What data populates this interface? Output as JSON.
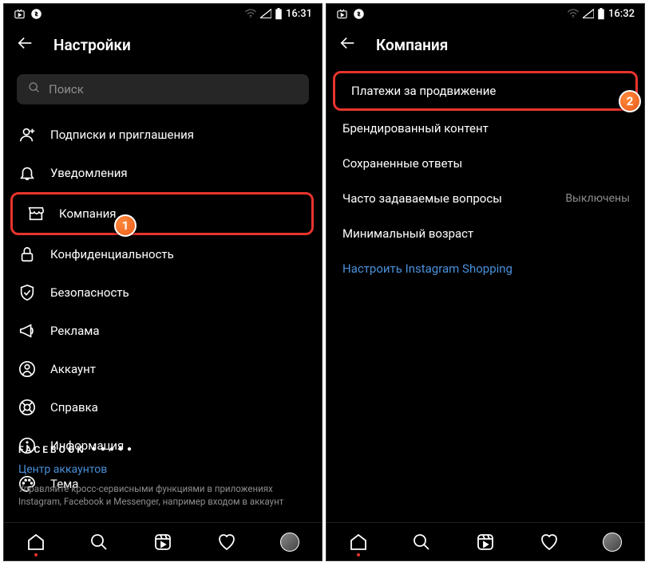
{
  "left": {
    "status": {
      "time": "16:31"
    },
    "header": {
      "title": "Настройки"
    },
    "search": {
      "placeholder": "Поиск"
    },
    "menu": [
      {
        "label": "Подписки и приглашения"
      },
      {
        "label": "Уведомления"
      },
      {
        "label": "Компания"
      },
      {
        "label": "Конфиденциальность"
      },
      {
        "label": "Безопасность"
      },
      {
        "label": "Реклама"
      },
      {
        "label": "Аккаунт"
      },
      {
        "label": "Справка"
      },
      {
        "label": "Информация"
      },
      {
        "label": "Тема"
      }
    ],
    "footer": {
      "brand": "FACEBOOK",
      "accounts_link": "Центр аккаунтов",
      "desc": "Управляйте кросс-сервисными функциями в приложениях Instagram, Facebook и Messenger, например входом в аккаунт"
    },
    "callout": "1"
  },
  "right": {
    "status": {
      "time": "16:32"
    },
    "header": {
      "title": "Компания"
    },
    "menu": [
      {
        "label": "Платежи за продвижение"
      },
      {
        "label": "Брендированный контент"
      },
      {
        "label": "Сохраненные ответы"
      },
      {
        "label": "Часто задаваемые вопросы",
        "trail": "Выключены"
      },
      {
        "label": "Минимальный возраст"
      },
      {
        "label": "Настроить Instagram Shopping"
      }
    ],
    "callout": "2"
  }
}
